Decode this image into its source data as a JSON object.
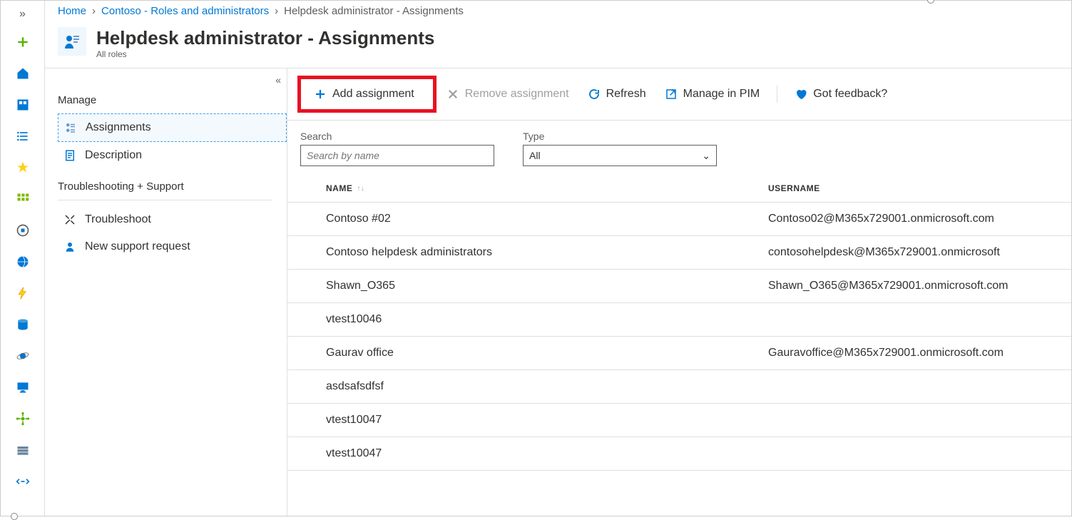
{
  "breadcrumb": {
    "home": "Home",
    "roles": "Contoso - Roles and administrators",
    "current": "Helpdesk administrator - Assignments"
  },
  "header": {
    "title": "Helpdesk administrator - Assignments",
    "subtitle": "All roles"
  },
  "sidemenu": {
    "manage": "Manage",
    "assignments": "Assignments",
    "description": "Description",
    "troubleshoot_heading": "Troubleshooting + Support",
    "troubleshoot": "Troubleshoot",
    "new_support": "New support request"
  },
  "toolbar": {
    "add": "Add assignment",
    "remove": "Remove assignment",
    "refresh": "Refresh",
    "manage_pim": "Manage in PIM",
    "feedback": "Got feedback?"
  },
  "filters": {
    "search_label": "Search",
    "search_placeholder": "Search by name",
    "type_label": "Type",
    "type_value": "All"
  },
  "table": {
    "col_name": "NAME",
    "col_user": "USERNAME",
    "rows": [
      {
        "name": "Contoso #02",
        "user": "Contoso02@M365x729001.onmicrosoft.com"
      },
      {
        "name": "Contoso helpdesk administrators",
        "user": "contosohelpdesk@M365x729001.onmicrosoft"
      },
      {
        "name": "Shawn_O365",
        "user": "Shawn_O365@M365x729001.onmicrosoft.com"
      },
      {
        "name": "vtest10046",
        "user": ""
      },
      {
        "name": "Gaurav office",
        "user": "Gauravoffice@M365x729001.onmicrosoft.com"
      },
      {
        "name": "asdsafsdfsf",
        "user": ""
      },
      {
        "name": "vtest10047",
        "user": ""
      },
      {
        "name": "vtest10047",
        "user": ""
      }
    ]
  }
}
